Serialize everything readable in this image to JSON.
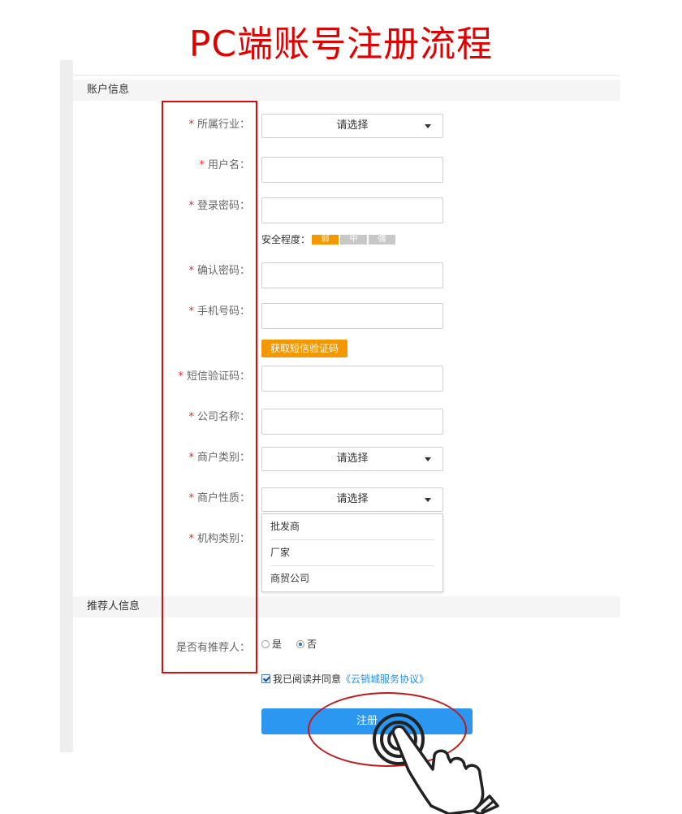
{
  "page": {
    "title": "PC端账号注册流程",
    "title_color": "#e00000"
  },
  "sections": {
    "account_info": "账户信息",
    "referrer_info": "推荐人信息"
  },
  "form": {
    "required_mark": "*",
    "industry": {
      "label": "所属行业：",
      "value": "请选择"
    },
    "username": {
      "label": "用户名：",
      "value": ""
    },
    "password": {
      "label": "登录密码：",
      "value": ""
    },
    "strength": {
      "label": "安全程度：",
      "weak": "弱",
      "medium": "中",
      "strong": "强",
      "active_color": "#f39800",
      "inactive_color": "#c8c8c8"
    },
    "confirm_password": {
      "label": "确认密码：",
      "value": ""
    },
    "phone": {
      "label": "手机号码：",
      "value": ""
    },
    "sms_button": "获取短信验证码",
    "sms_code": {
      "label": "短信验证码：",
      "value": ""
    },
    "company_name": {
      "label": "公司名称：",
      "value": ""
    },
    "merchant_category": {
      "label": "商户类别：",
      "value": "请选择"
    },
    "merchant_nature": {
      "label": "商户性质：",
      "value": "请选择",
      "options": [
        "批发商",
        "厂家",
        "商贸公司"
      ]
    },
    "org_category": {
      "label": "机构类别："
    },
    "has_referrer": {
      "label": "是否有推荐人：",
      "yes": "是",
      "no": "否",
      "selected": "否"
    },
    "agreement": {
      "text": "我已阅读并同意",
      "link": "《云销城服务协议》",
      "checked": true
    },
    "submit": "注册"
  },
  "colors": {
    "primary": "#2b97f0",
    "sms_orange": "#f39800",
    "annotation_red": "#d01010"
  }
}
